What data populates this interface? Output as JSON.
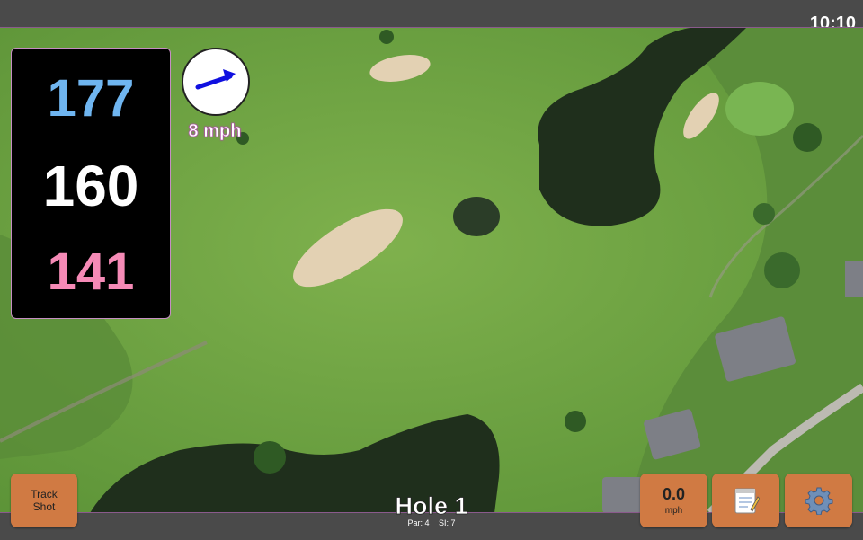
{
  "status_bar": {
    "time": "10:10"
  },
  "yardages": {
    "back": "177",
    "middle": "160",
    "front": "141"
  },
  "wind": {
    "speed_label": "8 mph",
    "direction_icon": "wind-arrow-icon",
    "arrow_color": "#1010e0"
  },
  "buttons": {
    "track_shot": {
      "line1": "Track",
      "line2": "Shot"
    },
    "speed": {
      "value": "0.0",
      "unit": "mph"
    },
    "notes_icon": "notepad-icon",
    "settings_icon": "gear-icon"
  },
  "hole": {
    "title": "Hole 1",
    "par": "Par: 4",
    "stroke_index": "SI: 7"
  },
  "colors": {
    "back_yardage": "#6fb5f0",
    "middle_yardage": "#ffffff",
    "front_yardage": "#f58ab6",
    "button": "#d07a43",
    "bar": "#4a4a4a"
  }
}
